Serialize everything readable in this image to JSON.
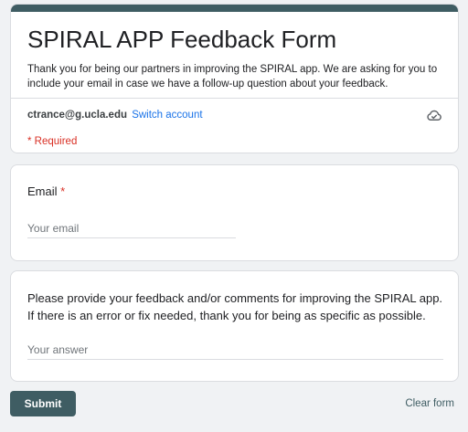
{
  "form": {
    "title": "SPIRAL APP Feedback Form",
    "description": "Thank you for being our partners in improving the SPIRAL app. We are asking for you to include your email in case we have a follow-up question about your feedback.",
    "account_email": "ctrance@g.ucla.edu",
    "switch_account_label": "Switch account",
    "required_note": "* Required",
    "accent_color": "#3f5d63"
  },
  "questions": [
    {
      "label": "Email",
      "required_marker": "*",
      "placeholder": "Your email",
      "value": ""
    },
    {
      "label": "Please provide your feedback and/or comments for improving the SPIRAL app. If there is an error or fix needed, thank you for being as specific as possible.",
      "placeholder": "Your answer",
      "value": ""
    }
  ],
  "actions": {
    "submit_label": "Submit",
    "clear_label": "Clear form"
  },
  "icons": {
    "save_status": "cloud-icon"
  }
}
